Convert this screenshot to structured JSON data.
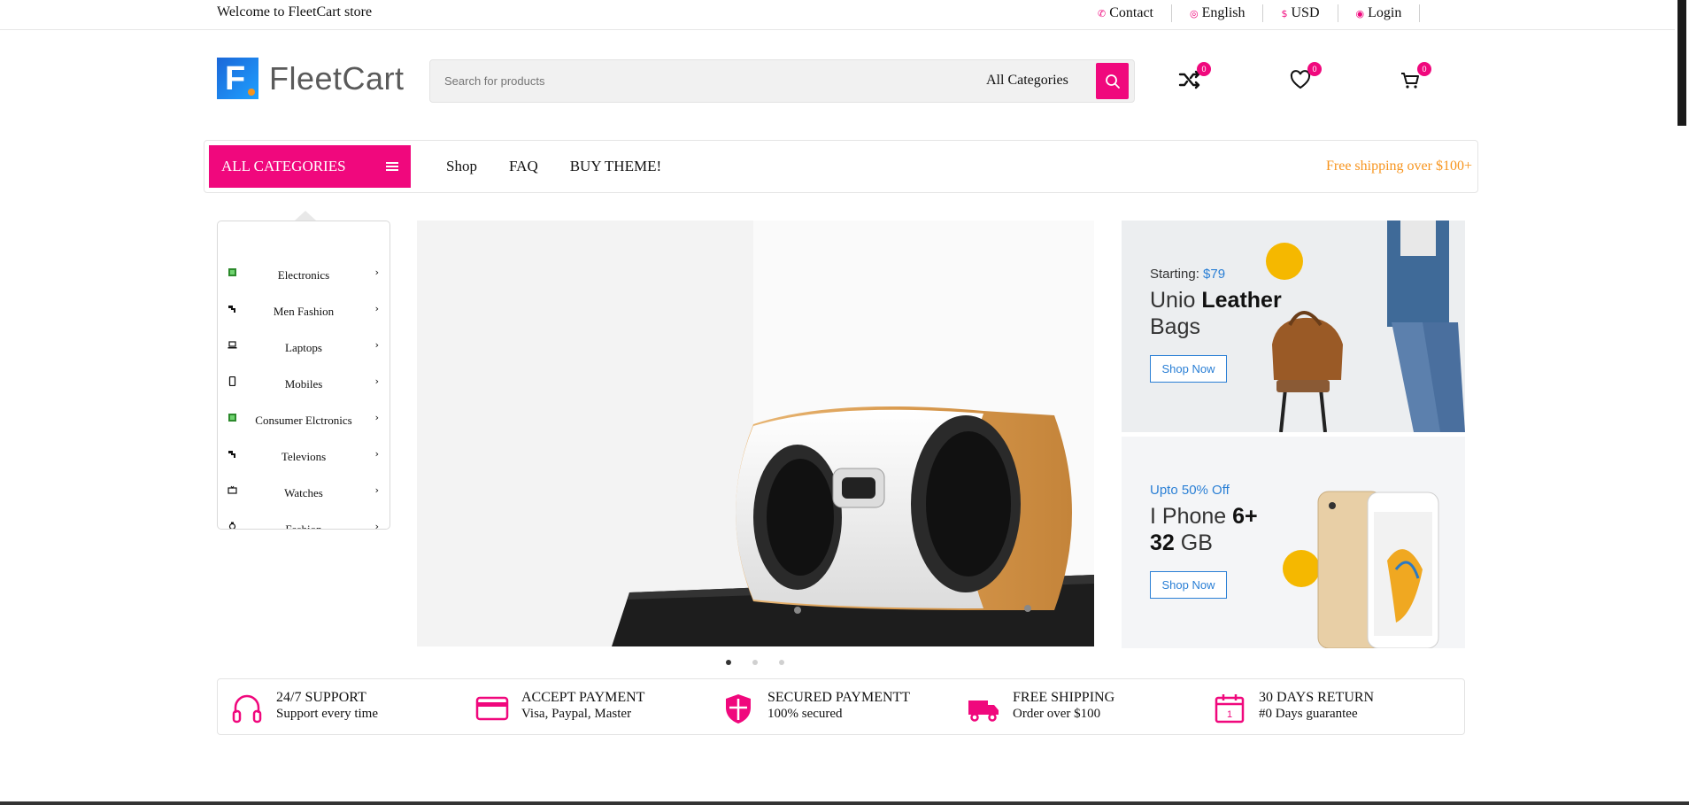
{
  "topbar": {
    "welcome": "Welcome to FleetCart store",
    "links": [
      {
        "icon": "phone-icon",
        "label": "Contact"
      },
      {
        "icon": "globe-icon",
        "label": "English"
      },
      {
        "icon": "dollar-icon",
        "label": "USD"
      },
      {
        "icon": "user-icon",
        "label": "Login"
      }
    ]
  },
  "header": {
    "logo_letter": "F",
    "logo_text": "FleetCart",
    "search_placeholder": "Search for products",
    "search_category": "All Categories",
    "compare_count": "0",
    "wishlist_count": "0",
    "cart_count": "0"
  },
  "nav": {
    "all_categories": "ALL CATEGORIES",
    "links": [
      "Shop",
      "FAQ",
      "BUY THEME!"
    ],
    "free_shipping": "Free shipping over $100+"
  },
  "categories": [
    {
      "label": "Electronics",
      "icon": "chip-icon"
    },
    {
      "label": "Men Fashion",
      "icon": "hanger-icon"
    },
    {
      "label": "Laptops",
      "icon": "laptop-icon"
    },
    {
      "label": "Mobiles",
      "icon": "mobile-icon"
    },
    {
      "label": "Consumer Elctronics",
      "icon": "chip-icon"
    },
    {
      "label": "Televions",
      "icon": "hanger-icon"
    },
    {
      "label": "Watches",
      "icon": "tv-icon"
    },
    {
      "label": "Fashion",
      "icon": "watch-icon"
    }
  ],
  "slider": {
    "slides": 3,
    "active": 1
  },
  "banners": [
    {
      "subtitle": "Starting: ",
      "price": "$79",
      "title_light": "Unio ",
      "title_bold": "Leather",
      "title_rest": " Bags",
      "button": "Shop Now"
    },
    {
      "subtitle": "Upto 50% Off",
      "title_light": "I Phone ",
      "title_bold": "6+",
      "title_bold2": "32",
      "title_rest": " GB",
      "button": "Shop Now"
    }
  ],
  "features": [
    {
      "icon": "headset-icon",
      "title": "24/7 SUPPORT",
      "sub": "Support every time"
    },
    {
      "icon": "credit-card-icon",
      "title": "ACCEPT PAYMENT",
      "sub": "Visa, Paypal, Master"
    },
    {
      "icon": "shield-icon",
      "title": "SECURED PAYMENTT",
      "sub": "100% secured"
    },
    {
      "icon": "truck-icon",
      "title": "FREE SHIPPING",
      "sub": "Order over $100"
    },
    {
      "icon": "calendar-icon",
      "title": "30 DAYS RETURN",
      "sub": "#0 Days guarantee"
    }
  ],
  "colors": {
    "accent": "#f0087d",
    "link_blue": "#2a7fd5",
    "shipping_orange": "#f7941d"
  }
}
